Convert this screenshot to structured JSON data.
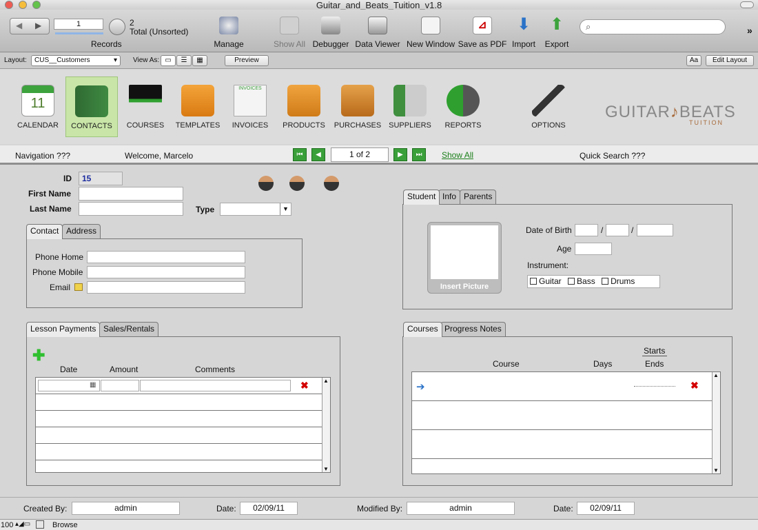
{
  "window": {
    "title": "Guitar_and_Beats_Tuition_v1.8"
  },
  "toolbar": {
    "record_number": "1",
    "record_count": "2",
    "total_label": "Total (Unsorted)",
    "records_label": "Records",
    "items": [
      "Manage",
      "Show All",
      "Debugger",
      "Data Viewer",
      "New Window",
      "Save as PDF",
      "Import",
      "Export"
    ],
    "search_placeholder": ""
  },
  "layout_bar": {
    "layout_label": "Layout:",
    "layout_value": "CUS__Customers",
    "view_as_label": "View As:",
    "preview_label": "Preview",
    "aa_label": "Aa",
    "edit_layout_label": "Edit Layout"
  },
  "nav_icons": {
    "calendar_day": "11",
    "invoices_tag": "INVOICES",
    "items": [
      "CALENDAR",
      "CONTACTS",
      "COURSES",
      "TEMPLATES",
      "INVOICES",
      "PRODUCTS",
      "PURCHASES",
      "SUPPLIERS",
      "REPORTS",
      "OPTIONS"
    ],
    "active": "CONTACTS"
  },
  "brand": {
    "logo_main": "GUITAR",
    "logo_main2": "BEATS",
    "logo_sub": "TUITION"
  },
  "navbar": {
    "navigation": "Navigation ???",
    "welcome": "Welcome, Marcelo",
    "record_of": "1 of 2",
    "show_all": "Show All",
    "quick_search": "Quick Search ???"
  },
  "record": {
    "id_label": "ID",
    "id_value": "15",
    "first_name_label": "First Name",
    "first_name": "",
    "last_name_label": "Last Name",
    "last_name": "",
    "type_label": "Type",
    "type_value": ""
  },
  "contact_tabs": {
    "tabs": [
      "Contact",
      "Address"
    ],
    "phone_home_label": "Phone Home",
    "phone_mobile_label": "Phone Mobile",
    "email_label": "Email"
  },
  "student_tabs": {
    "tabs": [
      "Student",
      "Info",
      "Parents"
    ],
    "insert_picture": "Insert Picture",
    "dob_label": "Date of Birth",
    "dob_sep": "/",
    "age_label": "Age",
    "instrument_label": "Instrument:",
    "instruments": [
      "Guitar",
      "Bass",
      "Drums"
    ]
  },
  "payments": {
    "tabs": [
      "Lesson Payments",
      "Sales/Rentals"
    ],
    "columns": [
      "Date",
      "Amount",
      "Comments"
    ]
  },
  "courses": {
    "tabs": [
      "Courses",
      "Progress Notes"
    ],
    "columns": [
      "Course",
      "Days",
      "Starts",
      "Ends"
    ]
  },
  "footer": {
    "created_by_label": "Created By:",
    "created_by": "admin",
    "date_label": "Date:",
    "created_date": "02/09/11",
    "modified_by_label": "Modified By:",
    "modified_by": "admin",
    "modified_date": "02/09/11"
  },
  "statusbar": {
    "zoom": "100",
    "mode": "Browse"
  },
  "colors": {
    "active_nav": "#c9e6a8",
    "link_green": "#1a7f1a",
    "delete_red": "#d40000",
    "id_blue": "#1a2a9e"
  }
}
